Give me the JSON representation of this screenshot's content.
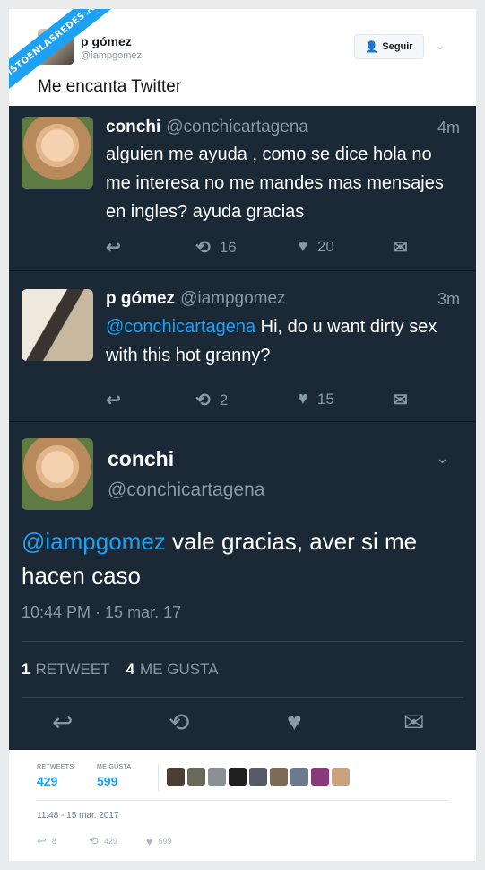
{
  "watermark": "VISTOENLASREDES",
  "watermark_suffix": ".com",
  "top": {
    "name": "p gómez",
    "handle": "@iampgomez",
    "follow_label": "Seguir",
    "text": "Me encanta Twitter"
  },
  "tweets": [
    {
      "name": "conchi",
      "handle": "@conchicartagena",
      "time": "4m",
      "text": "alguien me ayuda , como se dice hola no me interesa no me mandes mas mensajes en ingles? ayuda gracias",
      "retweets": "16",
      "likes": "20"
    },
    {
      "name": "p gómez",
      "handle": "@iampgomez",
      "time": "3m",
      "mention": "@conchicartagena",
      "text": " Hi, do u want dirty sex with this hot granny?",
      "retweets": "2",
      "likes": "15"
    }
  ],
  "detail": {
    "name": "conchi",
    "handle": "@conchicartagena",
    "mention": "@iampgomez",
    "text": " vale gracias, aver si me hacen caso",
    "timestamp": "10:44 PM · 15 mar. 17",
    "retweet_count": "1",
    "retweet_label": "RETWEET",
    "like_count": "4",
    "like_label": "ME GUSTA"
  },
  "bottom": {
    "retweets_label": "RETWEETS",
    "retweets_value": "429",
    "likes_label": "ME GUSTA",
    "likes_value": "599",
    "timestamp": "11:48 - 15 mar. 2017",
    "reply_count": "8",
    "retweet_count": "429",
    "like_count": "599"
  },
  "colors": {
    "accent": "#1da1f2",
    "dark_bg": "#1b2836",
    "muted": "#8899a6"
  },
  "icons": [
    "reply-icon",
    "retweet-icon",
    "heart-icon",
    "message-icon",
    "chevron-down-icon",
    "add-user-icon"
  ]
}
